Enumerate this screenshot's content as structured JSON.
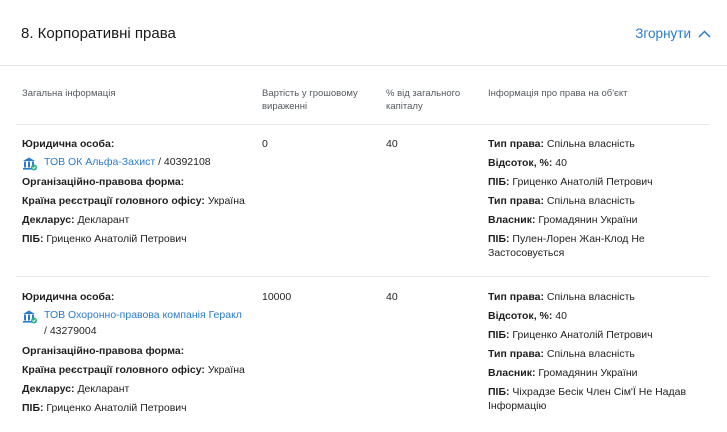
{
  "section": {
    "title": "8. Корпоративні права",
    "collapse_label": "Згорнути"
  },
  "columns": {
    "general": "Загальна інформація",
    "value_line1": "Вартість у грошовому",
    "value_line2": "вираженні",
    "percent_line1": "% від загального",
    "percent_line2": "капіталу",
    "rights": "Інформація про права на об'єкт"
  },
  "colors": {
    "accent": "#2a7bd0",
    "badge": "#22b07d"
  },
  "icons": {
    "entity": "institution-icon",
    "verified": "verified-check-icon",
    "collapse": "chevron-up-icon"
  },
  "rows": [
    {
      "entity_label": "Юридична особа:",
      "company_name": "ТОВ ОК Альфа-Захист",
      "company_code": " / 40392108",
      "org_form_label": "Організаційно-правова форма:",
      "org_form_value": "",
      "country_label": "Країна реєстрації головного офісу:",
      "country_value": " Україна",
      "declarant_label": "Декларус:",
      "declarant_value": " Декларант",
      "pib_label": "ПІБ:",
      "pib_value": " Гриценко Анатолій Петрович",
      "value": "0",
      "percent": "40",
      "rights": [
        {
          "label": "Тип права:",
          "value": " Спільна власність"
        },
        {
          "label": "Відсоток, %:",
          "value": " 40"
        },
        {
          "label": "ПІБ:",
          "value": " Гриценко Анатолій Петрович"
        },
        {
          "label": "Тип права:",
          "value": " Спільна власність"
        },
        {
          "label": "Власник:",
          "value": " Громадянин України"
        },
        {
          "label": "ПІБ:",
          "value": " Пулен-Лорен Жан-Клод Не Застосовується"
        }
      ]
    },
    {
      "entity_label": "Юридична особа:",
      "company_name": "ТОВ Охоронно-правова компанія Геракл",
      "company_code": " / 43279004",
      "org_form_label": "Організаційно-правова форма:",
      "org_form_value": "",
      "country_label": "Країна реєстрації головного офісу:",
      "country_value": " Україна",
      "declarant_label": "Декларус:",
      "declarant_value": " Декларант",
      "pib_label": "ПІБ:",
      "pib_value": " Гриценко Анатолій Петрович",
      "value": "10000",
      "percent": "40",
      "rights": [
        {
          "label": "Тип права:",
          "value": " Спільна власність"
        },
        {
          "label": "Відсоток, %:",
          "value": " 40"
        },
        {
          "label": "ПІБ:",
          "value": " Гриценко Анатолій Петрович"
        },
        {
          "label": "Тип права:",
          "value": " Спільна власність"
        },
        {
          "label": "Власник:",
          "value": " Громадянин України"
        },
        {
          "label": "ПІБ:",
          "value": " Чіхрадзе Бесік Член Сім'Ї Не Надав Інформацію"
        }
      ]
    }
  ]
}
